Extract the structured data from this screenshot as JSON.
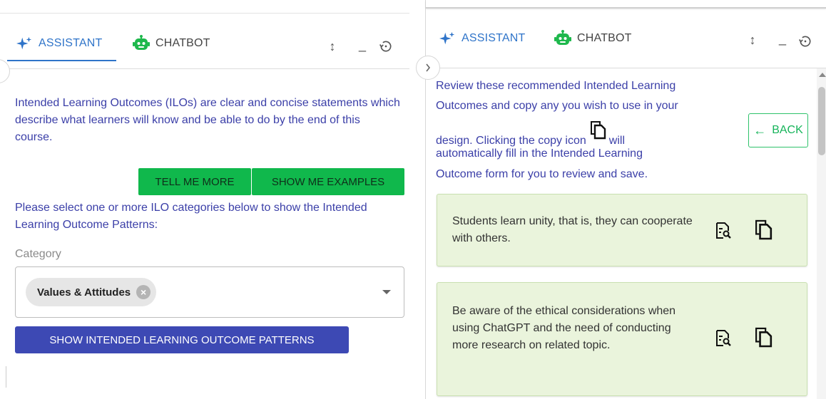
{
  "left_panel": {
    "tabs": [
      {
        "label": "ASSISTANT",
        "icon": "sparkle-icon",
        "active": true
      },
      {
        "label": "CHATBOT",
        "icon": "robot-icon",
        "active": false
      }
    ],
    "tools": {
      "resize": "↕",
      "minimize": "_",
      "history": "history-icon"
    },
    "intro": "Intended Learning Outcomes (ILOs) are clear and concise statements which describe what learners will know and be able to do by the end of this course.",
    "buttons": {
      "tell_more": "TELL ME MORE",
      "show_examples": "SHOW ME EXAMPLES"
    },
    "select_prompt": "Please select one or more ILO categories below to show the Intended Learning Outcome Patterns:",
    "category_label": "Category",
    "selected_chip": "Values & Attitudes",
    "show_patterns": "SHOW INTENDED LEARNING OUTCOME PATTERNS"
  },
  "right_panel": {
    "tabs": [
      {
        "label": "ASSISTANT",
        "icon": "sparkle-icon",
        "active": true
      },
      {
        "label": "CHATBOT",
        "icon": "robot-icon",
        "active": false
      }
    ],
    "instructions": {
      "line1": "Review these recommended Intended Learning",
      "line2": "Outcomes and copy any you wish to use in your",
      "line3a": "design. Clicking the copy icon",
      "line3b": "will",
      "line4": "automatically fill in the Intended Learning",
      "line5": "Outcome form for you to review and save."
    },
    "back_label": "BACK",
    "cards": [
      {
        "text": "Students learn unity, that is, they can cooperate with others."
      },
      {
        "text": "Be aware of the ethical considerations when using ChatGPT and the need of conducting more research on related topic."
      }
    ]
  },
  "colors": {
    "accent_blue": "#2f74c9",
    "text_indigo": "#3b3fa8",
    "green_button": "#10b84c",
    "blue_button": "#3d49b4",
    "robot_green": "#1eb84c",
    "card_bg": "#eaf4dc"
  }
}
